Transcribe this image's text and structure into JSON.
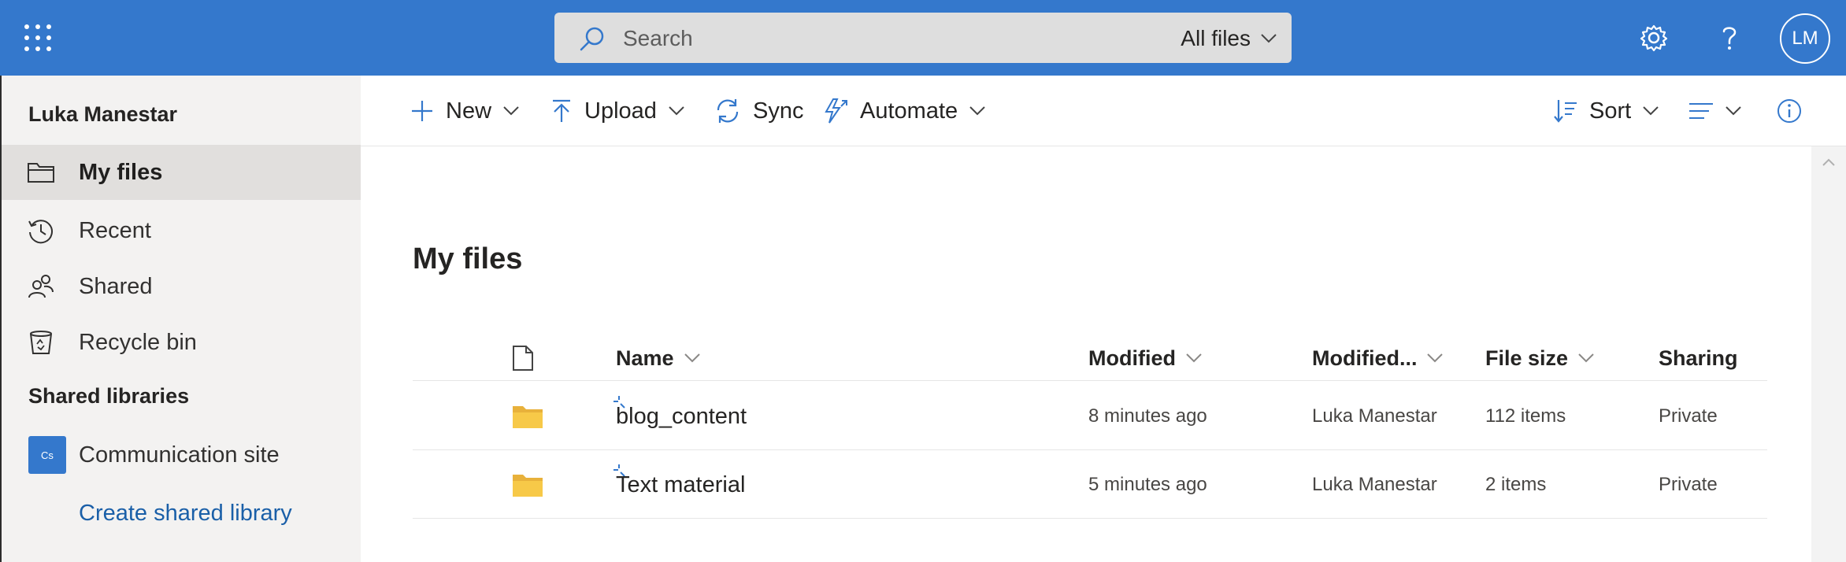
{
  "topbar": {
    "app_launcher_icon": "waffle-icon",
    "search_placeholder": "Search",
    "search_scope": "All files",
    "settings_icon": "gear-icon",
    "help_icon": "question-icon",
    "avatar_initials": "LM",
    "brand_color": "#3478cc"
  },
  "sidebar": {
    "user_name": "Luka Manestar",
    "items": [
      {
        "label": "My files",
        "icon": "folder-icon",
        "active": true
      },
      {
        "label": "Recent",
        "icon": "history-icon"
      },
      {
        "label": "Shared",
        "icon": "people-icon"
      },
      {
        "label": "Recycle bin",
        "icon": "recycle-bin-icon"
      }
    ],
    "shared_libraries_title": "Shared libraries",
    "library": {
      "badge": "Cs",
      "label": "Communication site"
    },
    "create_link": "Create shared library"
  },
  "commandbar": {
    "new": "New",
    "upload": "Upload",
    "sync": "Sync",
    "automate": "Automate",
    "sort": "Sort"
  },
  "main": {
    "title": "My files",
    "columns": {
      "name": "Name",
      "modified": "Modified",
      "modified_by": "Modified...",
      "file_size": "File size",
      "sharing": "Sharing"
    },
    "rows": [
      {
        "name": "blog_content",
        "modified": "8 minutes ago",
        "modified_by": "Luka Manestar",
        "file_size": "112 items",
        "sharing": "Private"
      },
      {
        "name": "Text material",
        "modified": "5 minutes ago",
        "modified_by": "Luka Manestar",
        "file_size": "2 items",
        "sharing": "Private"
      }
    ]
  }
}
